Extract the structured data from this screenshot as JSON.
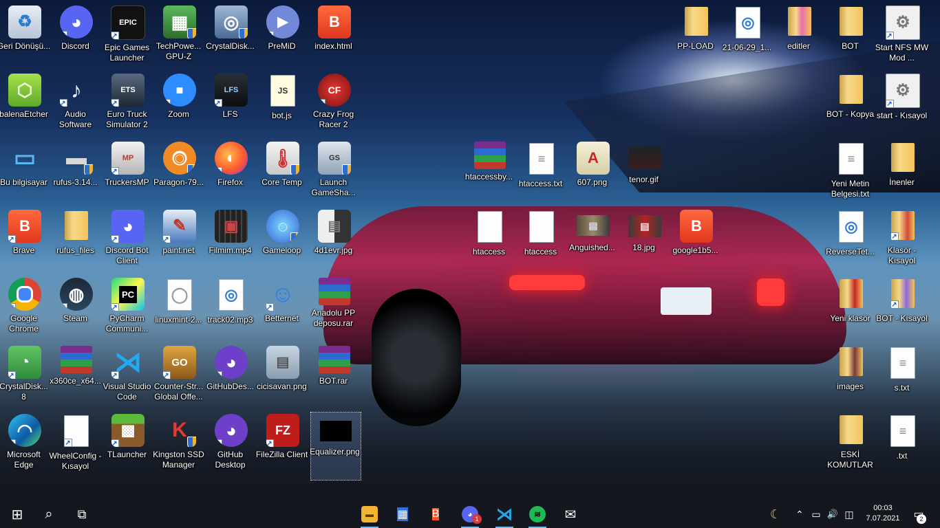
{
  "desktop": {
    "icons": {
      "geri_donusum": {
        "label": "Geri Dönüşü...",
        "glyph": "♻"
      },
      "discord": {
        "label": "Discord",
        "glyph": "◕"
      },
      "epic_games": {
        "label": "Epic Games Launcher",
        "glyph": "EPIC"
      },
      "techpowerup": {
        "label": "TechPowe... GPU-Z",
        "glyph": "▦"
      },
      "crystaldisk_info": {
        "label": "CrystalDisk...",
        "glyph": "◎"
      },
      "premid": {
        "label": "PreMiD",
        "glyph": "▶"
      },
      "index_html": {
        "label": "index.html",
        "glyph": "B"
      },
      "balenaetcher": {
        "label": "balenaEtcher",
        "glyph": "⬡"
      },
      "audio_software": {
        "label": "Audio Software",
        "glyph": "♪"
      },
      "euro_truck": {
        "label": "Euro Truck Simulator 2",
        "glyph": "ETS"
      },
      "zoom": {
        "label": "Zoom",
        "glyph": "■"
      },
      "lfs": {
        "label": "LFS",
        "glyph": "LFS"
      },
      "bot_js": {
        "label": "bot.js",
        "glyph": "JS"
      },
      "crazy_frog": {
        "label": "Crazy Frog Racer 2",
        "glyph": "CF"
      },
      "bu_bilgisayar": {
        "label": "Bu bilgisayar",
        "glyph": "▭"
      },
      "rufus_exe": {
        "label": "rufus-3.14...",
        "glyph": "▬"
      },
      "truckersmp": {
        "label": "TruckersMP",
        "glyph": "MP"
      },
      "paragon": {
        "label": "Paragon-79...",
        "glyph": "◉"
      },
      "firefox": {
        "label": "Firefox",
        "glyph": "◐"
      },
      "core_temp": {
        "label": "Core Temp",
        "glyph": "🌡"
      },
      "launch_gameshark": {
        "label": "Launch GameSha...",
        "glyph": "GS"
      },
      "brave": {
        "label": "Brave",
        "glyph": "B"
      },
      "rufus_files": {
        "label": "rufus_files",
        "glyph": ""
      },
      "discord_bot_client": {
        "label": "Discord Bot Client",
        "glyph": "◕"
      },
      "paint_net": {
        "label": "paint.net",
        "glyph": "✎"
      },
      "filmim": {
        "label": "Filmim.mp4",
        "glyph": "▣"
      },
      "gameloop": {
        "label": "Gameloop",
        "glyph": "◌"
      },
      "4d1evr": {
        "label": "4d1evr.jpg",
        "glyph": "▤"
      },
      "google_chrome": {
        "label": "Google Chrome",
        "glyph": "◉"
      },
      "steam": {
        "label": "Steam",
        "glyph": "◍"
      },
      "pycharm": {
        "label": "PyCharm Communi...",
        "glyph": "PC"
      },
      "linuxmint": {
        "label": "linuxmint-2...",
        "glyph": "◯"
      },
      "track02": {
        "label": "track02.mp3",
        "glyph": "◎"
      },
      "betternet": {
        "label": "Betternet",
        "glyph": "☺"
      },
      "anadolu_pp": {
        "label": "Anadolu PP deposu.rar",
        "glyph": ""
      },
      "crystaldisk_8": {
        "label": "CrystalDisk... 8",
        "glyph": "◔"
      },
      "x360ce": {
        "label": "x360ce_x64...",
        "glyph": ""
      },
      "vscode": {
        "label": "Visual Studio Code",
        "glyph": "⋊"
      },
      "csgo": {
        "label": "Counter-Str... Global Offe...",
        "glyph": "GO"
      },
      "githubdesktop_short": {
        "label": "GitHubDes...",
        "glyph": "◕"
      },
      "cicisavan": {
        "label": "cicisavan.png",
        "glyph": "▤"
      },
      "bot_rar": {
        "label": "BOT.rar",
        "glyph": ""
      },
      "microsoft_edge": {
        "label": "Microsoft Edge",
        "glyph": "◠"
      },
      "wheelconfig": {
        "label": "WheelConfig - Kısayol",
        "glyph": ""
      },
      "tlauncher": {
        "label": "TLauncher",
        "glyph": "▩"
      },
      "kingston": {
        "label": "Kingston SSD Manager",
        "glyph": "K"
      },
      "github_desktop": {
        "label": "GitHub Desktop",
        "glyph": "◕"
      },
      "filezilla": {
        "label": "FileZilla Client",
        "glyph": "FZ"
      },
      "equalizer": {
        "label": "Equalizer.png",
        "glyph": ""
      },
      "htaccessby": {
        "label": "htaccessby...",
        "glyph": ""
      },
      "htaccess_txt": {
        "label": "htaccess.txt",
        "glyph": "≡"
      },
      "img_607": {
        "label": "607.png",
        "glyph": "A"
      },
      "tenor_gif": {
        "label": "tenor.gif",
        "glyph": ""
      },
      "htaccess_a": {
        "label": "htaccess",
        "glyph": ""
      },
      "htaccess_b": {
        "label": "htaccess",
        "glyph": ""
      },
      "anguished": {
        "label": "Anguished...",
        "glyph": "▤"
      },
      "img_18": {
        "label": "18.jpg",
        "glyph": "▤"
      },
      "google1b5": {
        "label": "google1b5...",
        "glyph": "B"
      },
      "pp_load": {
        "label": "PP-LOAD",
        "glyph": ""
      },
      "date_file": {
        "label": "21-06-29_1...",
        "glyph": "◎"
      },
      "editler": {
        "label": "editler",
        "glyph": ""
      },
      "bot_folder": {
        "label": "BOT",
        "glyph": ""
      },
      "start_nfs": {
        "label": "Start NFS MW Mod ...",
        "glyph": "⚙"
      },
      "bot_kopya": {
        "label": "BOT - Kopya",
        "glyph": ""
      },
      "start_kisayol": {
        "label": "start - Kısayol",
        "glyph": "⚙"
      },
      "yeni_metin": {
        "label": "Yeni Metin Belgesi.txt",
        "glyph": "≡"
      },
      "inenler": {
        "label": "İnenler",
        "glyph": ""
      },
      "reversetet": {
        "label": "ReverseTet...",
        "glyph": "◎"
      },
      "klasor_kisayol": {
        "label": "Klasör - Kısayol",
        "glyph": ""
      },
      "yeni_klasor": {
        "label": "Yeni klasör",
        "glyph": ""
      },
      "bot_kisayol": {
        "label": "BOT - Kısayol",
        "glyph": ""
      },
      "images": {
        "label": "images",
        "glyph": ""
      },
      "s_txt": {
        "label": "s.txt",
        "glyph": "≡"
      },
      "eski_komutlar": {
        "label": "ESKİ KOMUTLAR",
        "glyph": ""
      },
      "dot_txt": {
        "label": ".txt",
        "glyph": "≡"
      }
    }
  },
  "taskbar": {
    "start_glyph": "⊞",
    "search_glyph": "⌕",
    "taskview_glyph": "⧉",
    "apps": {
      "explorer": {
        "glyph": "▬",
        "color": "#f2b634"
      },
      "store": {
        "glyph": "▦",
        "color": "#2f6fe0"
      },
      "brave": {
        "glyph": "B",
        "color": "#fb542b"
      },
      "discord": {
        "glyph": "◕",
        "color": "#5865f2",
        "badge": "1"
      },
      "vscode": {
        "glyph": "⋊",
        "color": "#1f7bd6"
      },
      "spotify": {
        "glyph": "≋",
        "color": "#1db954"
      },
      "mail": {
        "glyph": "✉",
        "color": "#3a3f46"
      }
    },
    "tray": {
      "moon": "☾",
      "chevron": "⌃",
      "network": "▭",
      "volume": "🔊",
      "camera": "◫",
      "time": "00:03",
      "date": "7.07.2021",
      "notifications": "▭",
      "notification_count": "2"
    }
  }
}
